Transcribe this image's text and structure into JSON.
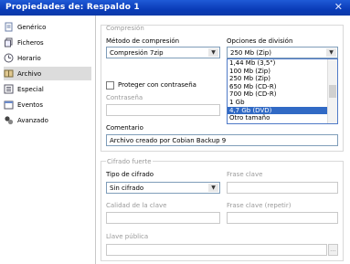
{
  "window": {
    "title": "Propiedades de: Respaldo 1",
    "close_glyph": "✕"
  },
  "sidebar": {
    "items": [
      {
        "label": "Genérico",
        "icon": "page-icon"
      },
      {
        "label": "Ficheros",
        "icon": "files-icon"
      },
      {
        "label": "Horario",
        "icon": "clock-icon"
      },
      {
        "label": "Archivo",
        "icon": "archive-icon",
        "selected": true
      },
      {
        "label": "Especial",
        "icon": "list-icon"
      },
      {
        "label": "Eventos",
        "icon": "events-icon"
      },
      {
        "label": "Avanzado",
        "icon": "advanced-icon"
      }
    ]
  },
  "compression": {
    "group_label": "Compresión",
    "method_label": "Método de compresión",
    "method_value": "Compresión 7zip",
    "split_label": "Opciones de división",
    "split_value": "250 Mb (Zip)",
    "split_options": [
      "1,44 Mb (3,5\")",
      "100 Mb (Zip)",
      "250 Mb (Zip)",
      "650 Mb (CD-R)",
      "700 Mb (CD-R)",
      "1 Gb",
      "4,7 Gb (DVD)",
      "Otro tamaño"
    ],
    "split_selected_index": 6,
    "protect_label": "Proteger con contraseña",
    "protect_checked": false,
    "password_label": "Contraseña",
    "password_value": "",
    "comment_label": "Comentario",
    "comment_value": "Archivo creado por Cobian Backup 9"
  },
  "encryption": {
    "group_label": "Cifrado fuerte",
    "type_label": "Tipo de cifrado",
    "type_value": "Sin cifrado",
    "passphrase_label": "Frase clave",
    "passphrase_value": "",
    "quality_label": "Calidad de la clave",
    "passphrase_repeat_label": "Frase clave (repetir)",
    "passphrase_repeat_value": "",
    "public_key_label": "Llave pública",
    "public_key_value": "",
    "browse_label": "..."
  },
  "colors": {
    "titlebar": "#0a3cb8",
    "selection": "#316ac5"
  }
}
